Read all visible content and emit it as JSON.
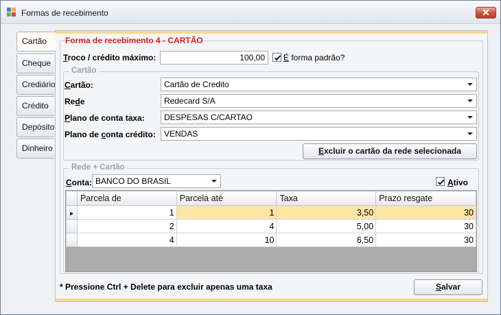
{
  "window": {
    "title": "Formas de recebimento",
    "close_glyph": "✕"
  },
  "tabs": [
    {
      "label": "Cartão"
    },
    {
      "label": "Cheque"
    },
    {
      "label": "Crediário"
    },
    {
      "label": "Crédito"
    },
    {
      "label": "Depósito"
    },
    {
      "label": "Dinheiro"
    }
  ],
  "form": {
    "title": "Forma de recebimento 4 - CARTÃO",
    "troco": {
      "label_first": "T",
      "label_rest": "roco / crédito máximo:",
      "value": "100,00"
    },
    "padrao": {
      "label_first": "É",
      "label_rest": " forma padrão?",
      "checked": true
    }
  },
  "cartao_group": {
    "title": "Cartão",
    "cartao": {
      "label_first": "C",
      "label_rest": "artão:",
      "value": "Cartão de Credito"
    },
    "rede": {
      "label_pre": "Re",
      "label_u": "d",
      "label_post": "e",
      "value": "Redecard S/A"
    },
    "taxa": {
      "label_first": "P",
      "label_rest": "lano de conta taxa:",
      "value": "DESPESAS C/CARTAO"
    },
    "credito": {
      "label_pre": "Plano de ",
      "label_u": "c",
      "label_post": "onta crédito:",
      "value": "VENDAS"
    },
    "excluir_button": {
      "label_first": "E",
      "label_rest": "xcluir o cartão da rede selecionada"
    }
  },
  "rede_group": {
    "title": "Rede + Cartão",
    "conta": {
      "label_first": "C",
      "label_rest": "onta:",
      "value": "BANCO DO BRASIL"
    },
    "ativo": {
      "label_first": "A",
      "label_rest": "tivo",
      "checked": true
    },
    "grid": {
      "columns": [
        "Parcela de",
        "Parcela até",
        "Taxa",
        "Prazo resgate"
      ],
      "rows": [
        [
          "1",
          "1",
          "3,50",
          "30"
        ],
        [
          "2",
          "4",
          "5,00",
          "30"
        ],
        [
          "4",
          "10",
          "6,50",
          "30"
        ]
      ],
      "current_row_glyph": "▸"
    }
  },
  "footer": {
    "note": "* Pressione Ctrl + Delete para excluir apenas uma taxa",
    "save_button": {
      "label_first": "S",
      "label_rest": "alvar"
    }
  },
  "colors": {
    "title_red": "#e02020",
    "highlight": "#fde6a4",
    "accent_bar": "#f6d98f"
  }
}
